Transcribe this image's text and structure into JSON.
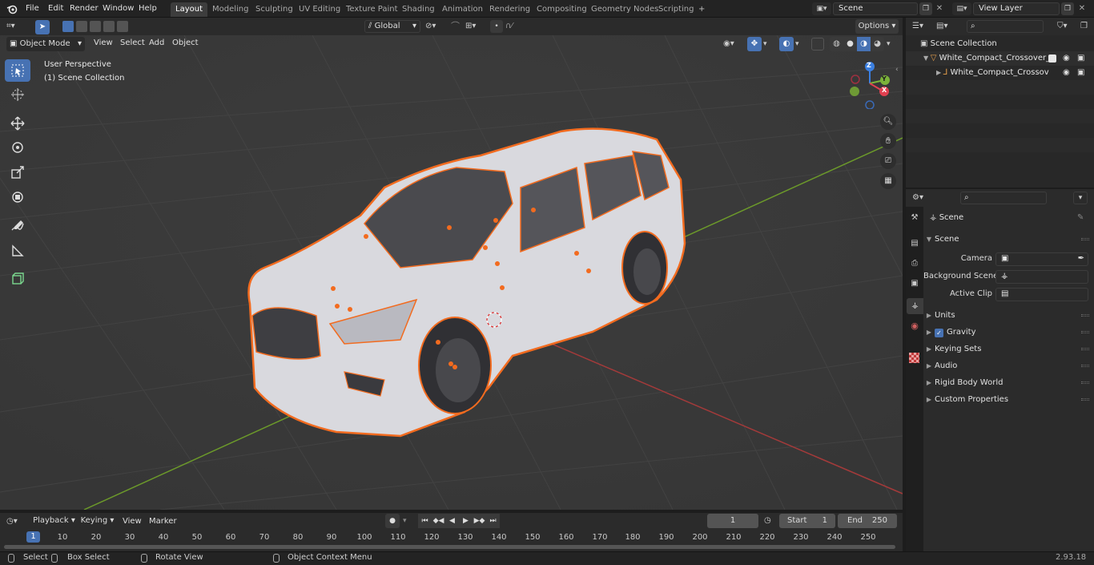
{
  "menubar": {
    "items": [
      "File",
      "Edit",
      "Render",
      "Window",
      "Help"
    ]
  },
  "workspaces": {
    "tabs": [
      "Layout",
      "Modeling",
      "Sculpting",
      "UV Editing",
      "Texture Paint",
      "Shading",
      "Animation",
      "Rendering",
      "Compositing",
      "Geometry Nodes",
      "Scripting"
    ],
    "active": "Layout",
    "add_label": "+"
  },
  "scene_field": {
    "value": "Scene"
  },
  "view_layer_field": {
    "value": "View Layer"
  },
  "header_tools": {
    "orientation": "Global",
    "options_label": "Options"
  },
  "viewport_header": {
    "mode": "Object Mode",
    "menus": [
      "View",
      "Select",
      "Add",
      "Object"
    ]
  },
  "viewport": {
    "perspective_label": "User Perspective",
    "collection_label": "(1) Scene Collection",
    "gizmo": {
      "x": "X",
      "y": "Y",
      "z": "Z"
    },
    "colors": {
      "grid_x": "#a33a3a",
      "grid_y": "#6c9a2a",
      "selection": "#f26b1f",
      "bg": "#393939"
    }
  },
  "outliner": {
    "root": "Scene Collection",
    "items": [
      {
        "label": "White_Compact_Crossover_S"
      },
      {
        "label": "White_Compact_Crossov"
      }
    ]
  },
  "properties": {
    "context_label": "Scene",
    "panel_title": "Scene",
    "fields": [
      {
        "label": "Camera",
        "value": ""
      },
      {
        "label": "Background Scene",
        "value": ""
      },
      {
        "label": "Active Clip",
        "value": ""
      }
    ],
    "sections": [
      {
        "label": "Units",
        "checkbox": false
      },
      {
        "label": "Gravity",
        "checkbox": true
      },
      {
        "label": "Keying Sets",
        "checkbox": false
      },
      {
        "label": "Audio",
        "checkbox": false
      },
      {
        "label": "Rigid Body World",
        "checkbox": false
      },
      {
        "label": "Custom Properties",
        "checkbox": false
      }
    ]
  },
  "timeline": {
    "menus": [
      "Playback",
      "Keying",
      "View",
      "Marker"
    ],
    "current_frame": "1",
    "start_label": "Start",
    "start_value": "1",
    "end_label": "End",
    "end_value": "250",
    "ruler_current": "1",
    "ruler_ticks": [
      "10",
      "20",
      "30",
      "40",
      "50",
      "60",
      "70",
      "80",
      "90",
      "100",
      "110",
      "120",
      "130",
      "140",
      "150",
      "160",
      "170",
      "180",
      "190",
      "200",
      "210",
      "220",
      "230",
      "240",
      "250"
    ]
  },
  "statusbar": {
    "select": "Select",
    "box_select": "Box Select",
    "rotate_view": "Rotate View",
    "context_menu": "Object Context Menu",
    "version": "2.93.18"
  }
}
